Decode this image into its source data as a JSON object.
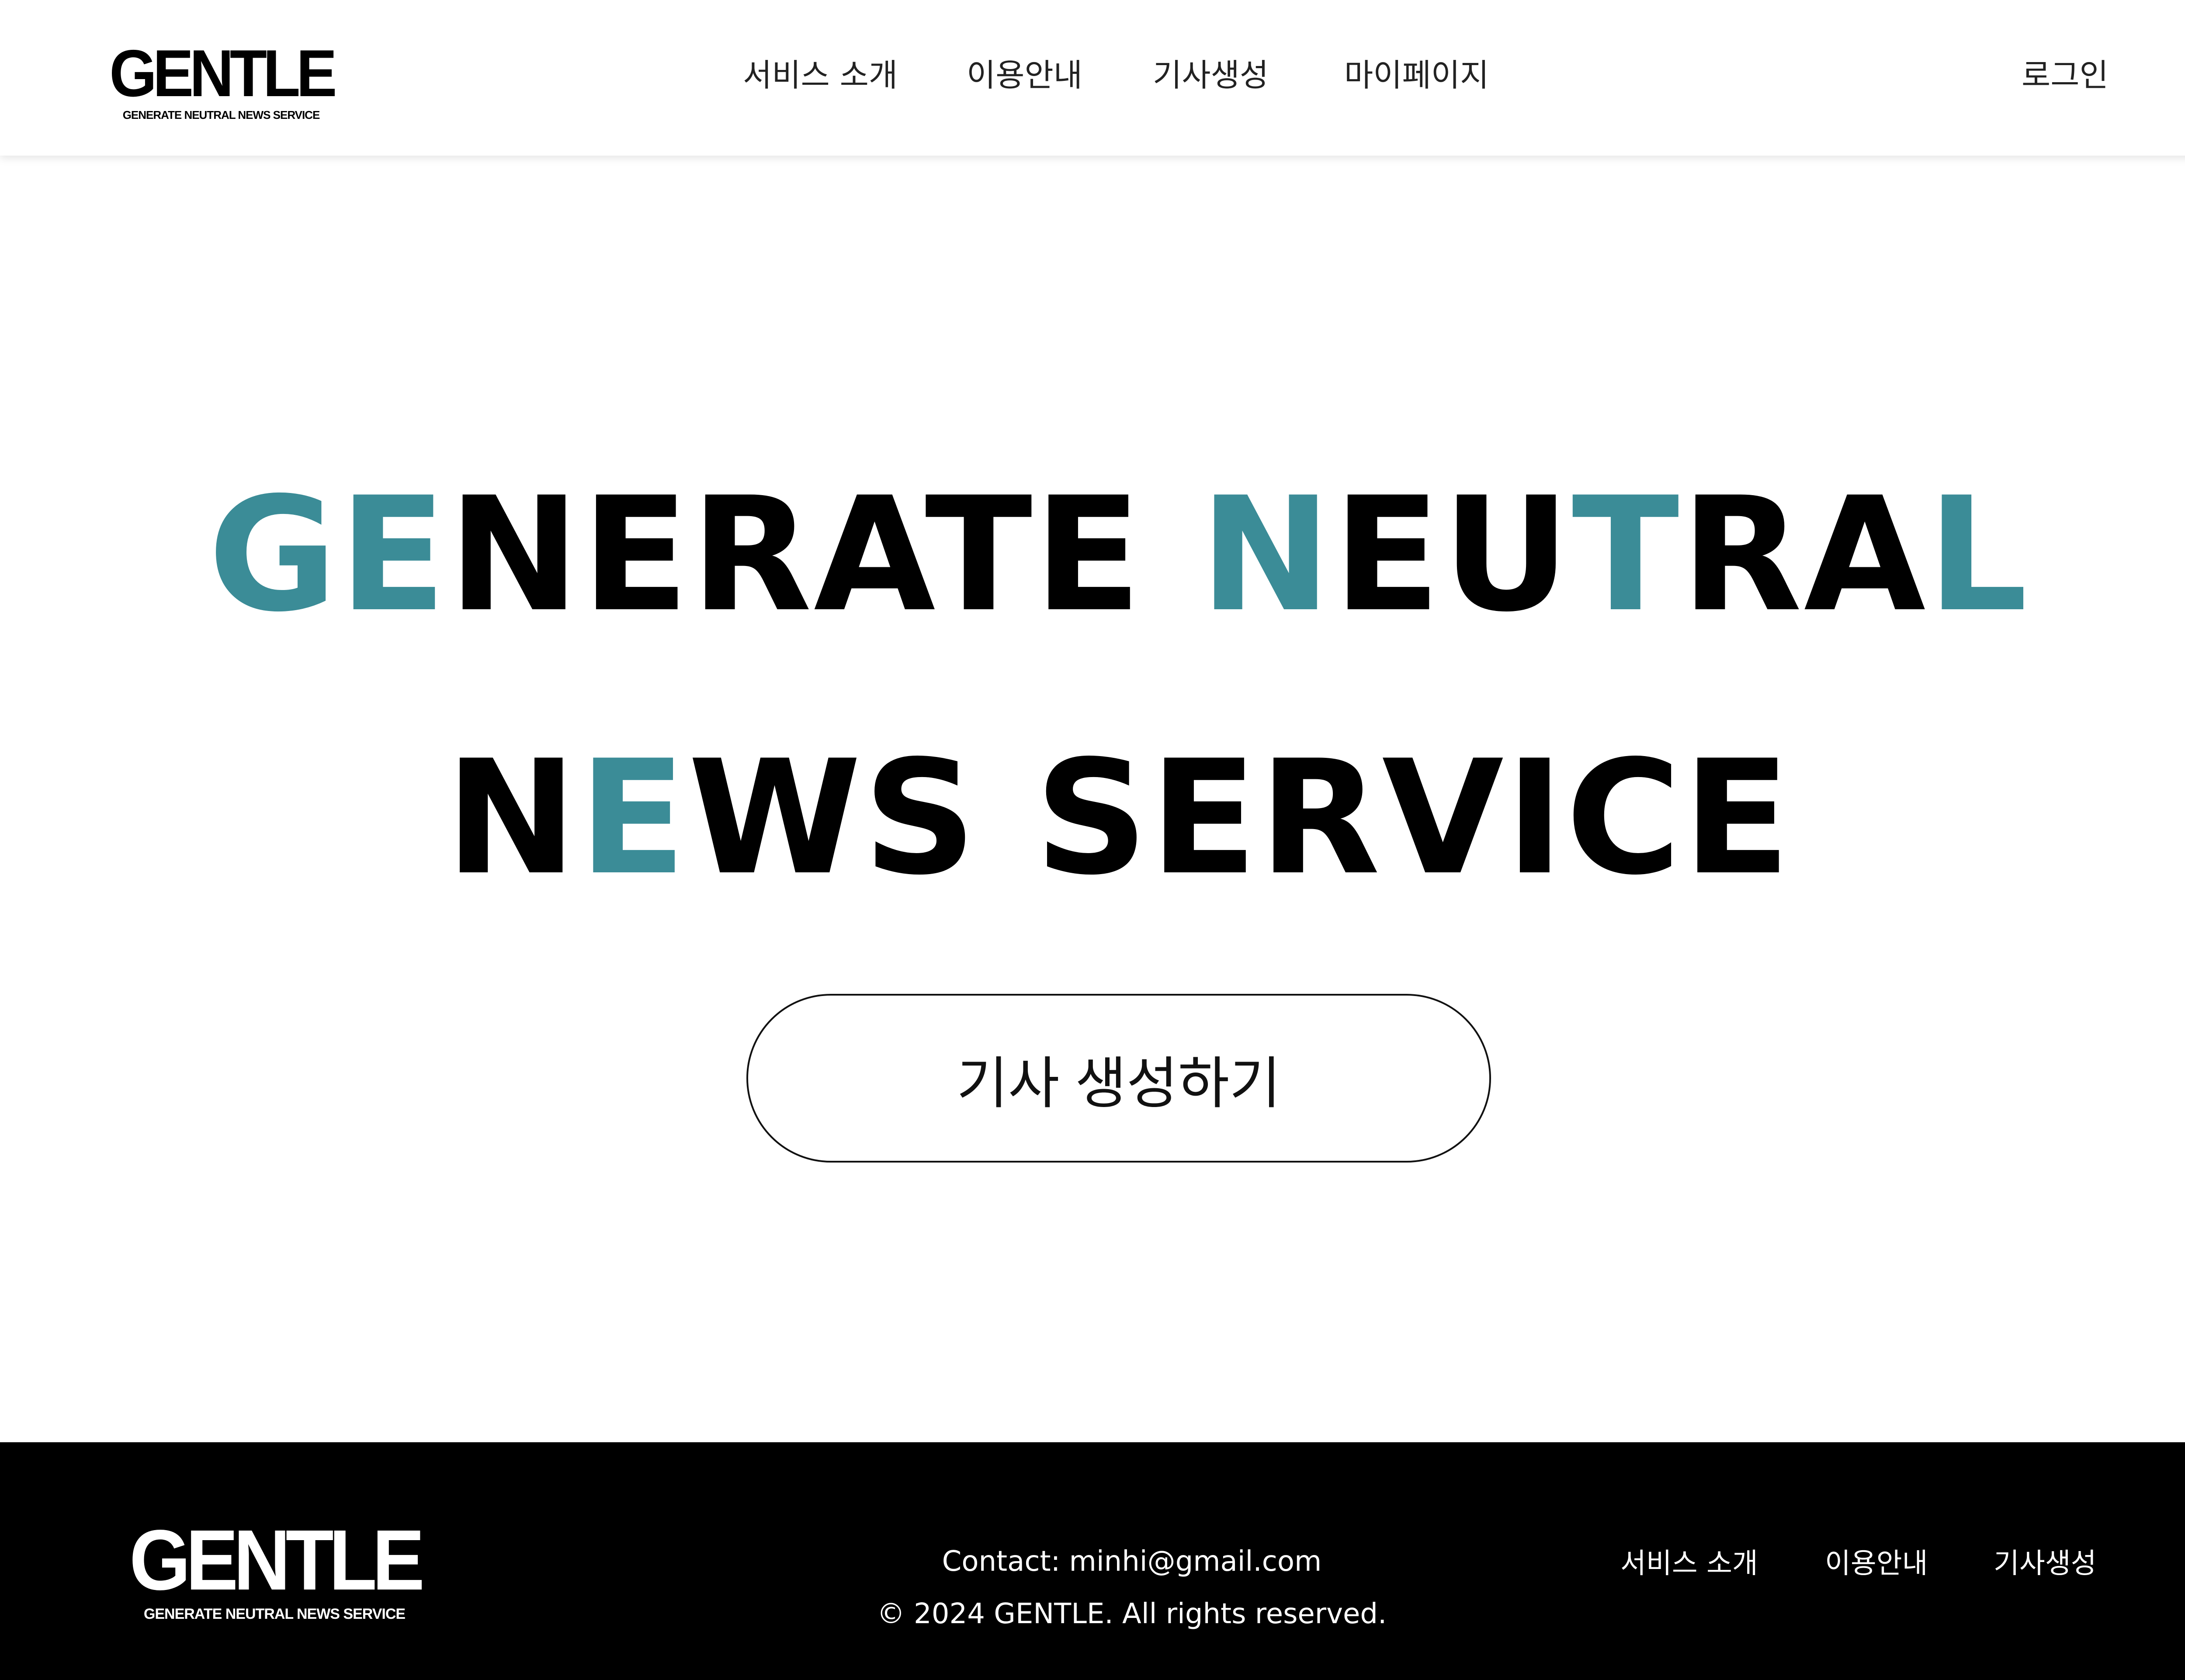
{
  "header": {
    "logo": {
      "main": "GENTLE",
      "sub": "GENERATE NEUTRAL NEWS SERVICE"
    },
    "nav": [
      {
        "label": "서비스 소개"
      },
      {
        "label": "이용안내"
      },
      {
        "label": "기사생성"
      },
      {
        "label": "마이페이지"
      }
    ],
    "login_label": "로그인"
  },
  "hero": {
    "line1": {
      "full_text": "GENERATE NEUTRAL",
      "segments": [
        {
          "text": "GE",
          "accent": true
        },
        {
          "text": "NERATE ",
          "accent": false
        },
        {
          "text": "N",
          "accent": true
        },
        {
          "text": "EU",
          "accent": false
        },
        {
          "text": "T",
          "accent": true
        },
        {
          "text": "RA",
          "accent": false
        },
        {
          "text": "L",
          "accent": true
        }
      ]
    },
    "line2": {
      "full_text": "NEWS SERVICE",
      "segments": [
        {
          "text": "N",
          "accent": false
        },
        {
          "text": "E",
          "accent": true
        },
        {
          "text": "WS SERVICE",
          "accent": false
        }
      ]
    },
    "cta_label": "기사 생성하기"
  },
  "footer": {
    "logo": {
      "main": "GENTLE",
      "sub": "GENERATE NEUTRAL NEWS SERVICE"
    },
    "contact": "Contact: minhi@gmail.com",
    "copyright": "© 2024 GENTLE. All rights reserved.",
    "nav": [
      {
        "label": "서비스 소개"
      },
      {
        "label": "이용안내"
      },
      {
        "label": "기사생성"
      }
    ]
  },
  "colors": {
    "accent": "#3b8c97",
    "text": "#000000",
    "background": "#ffffff",
    "footer_background": "#000000",
    "footer_text": "#ffffff"
  }
}
